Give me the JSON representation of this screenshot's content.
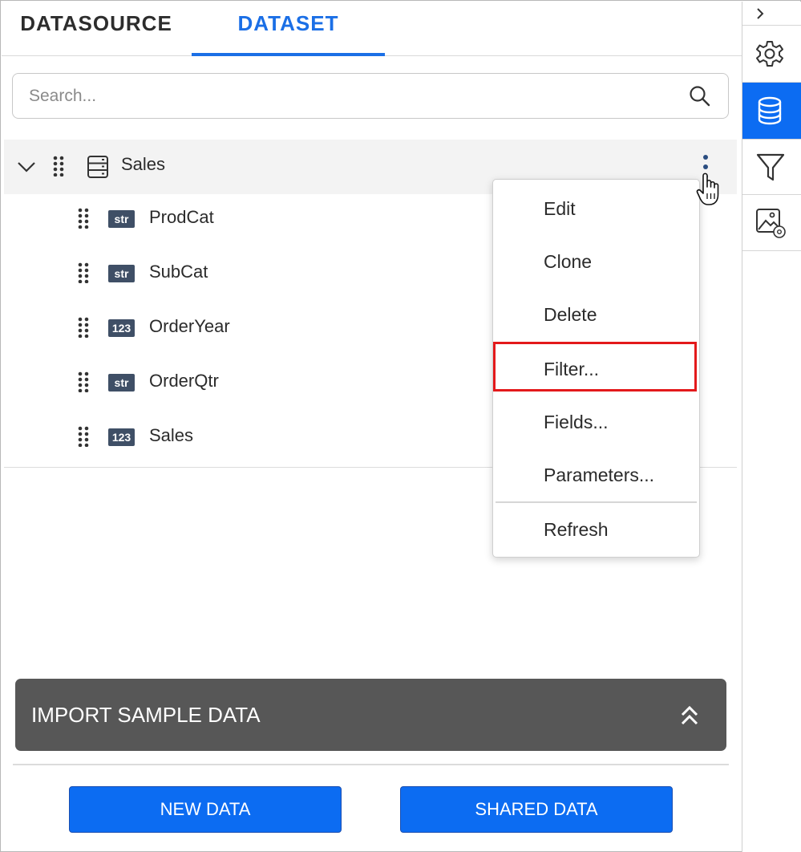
{
  "tabs": {
    "datasource": "DATASOURCE",
    "dataset": "DATASET",
    "active": "dataset"
  },
  "search": {
    "placeholder": "Search..."
  },
  "tree": {
    "root": {
      "label": "Sales"
    },
    "fields": [
      {
        "type": "str",
        "label": "ProdCat"
      },
      {
        "type": "str",
        "label": "SubCat"
      },
      {
        "type": "123",
        "label": "OrderYear"
      },
      {
        "type": "str",
        "label": "OrderQtr"
      },
      {
        "type": "123",
        "label": "Sales"
      }
    ]
  },
  "context_menu": {
    "items": [
      "Edit",
      "Clone",
      "Delete",
      "Filter...",
      "Fields...",
      "Parameters...",
      "Refresh"
    ],
    "highlighted": "Filter..."
  },
  "import_sample": {
    "label": "IMPORT SAMPLE DATA"
  },
  "buttons": {
    "new_data": "NEW DATA",
    "shared_data": "SHARED DATA"
  },
  "right_rail": {
    "items": [
      "collapse-icon",
      "settings-icon",
      "database-icon",
      "filter-icon",
      "image-settings-icon"
    ],
    "active": "database-icon"
  },
  "colors": {
    "accent": "#0c6cf2",
    "tab_active": "#1b6fe6",
    "import_bar": "#575757",
    "highlight_border": "#e3191b",
    "badge": "#3f4f66"
  }
}
